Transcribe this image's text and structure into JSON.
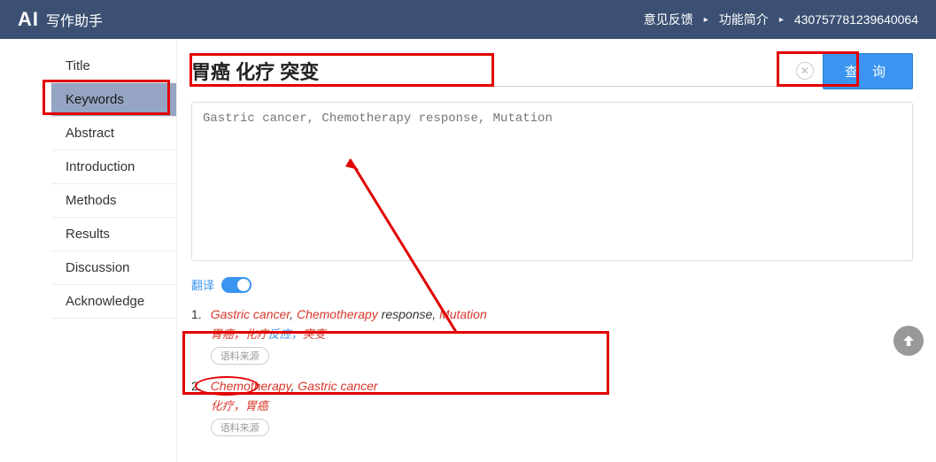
{
  "header": {
    "logo": "AI",
    "logo_subtitle": "写作助手",
    "feedback": "意见反馈",
    "features": "功能简介",
    "user_id": "430757781239640064"
  },
  "sidebar": {
    "items": [
      "Title",
      "Keywords",
      "Abstract",
      "Introduction",
      "Methods",
      "Results",
      "Discussion",
      "Acknowledge"
    ],
    "active_index": 1
  },
  "search": {
    "value": "胃癌 化疗 突变",
    "clear_icon": "✕",
    "button": "查 询"
  },
  "textarea": {
    "placeholder": "Gastric cancer, Chemotherapy response, Mutation"
  },
  "translate": {
    "label": "翻译",
    "on": true
  },
  "results": [
    {
      "num": "1.",
      "en_parts": [
        {
          "t": "Gastric cancer",
          "hl": true
        },
        {
          "t": ", ",
          "hl": false
        },
        {
          "t": "Chemotherapy",
          "hl": true
        },
        {
          "t": " response, ",
          "hl": false
        },
        {
          "t": "Mutation",
          "hl": true
        }
      ],
      "cn_parts": [
        {
          "t": "胃癌，化疗",
          "hl": true
        },
        {
          "t": "反应，",
          "hl": false
        },
        {
          "t": "突变",
          "hl": true
        }
      ],
      "source": "语料来源"
    },
    {
      "num": "2.",
      "en_parts": [
        {
          "t": "Chemotherapy",
          "hl": true
        },
        {
          "t": ", ",
          "hl": false
        },
        {
          "t": "Gastric cancer",
          "hl": true
        }
      ],
      "cn_parts": [
        {
          "t": "化疗，胃癌",
          "hl": true
        }
      ],
      "source": "语料来源"
    }
  ]
}
